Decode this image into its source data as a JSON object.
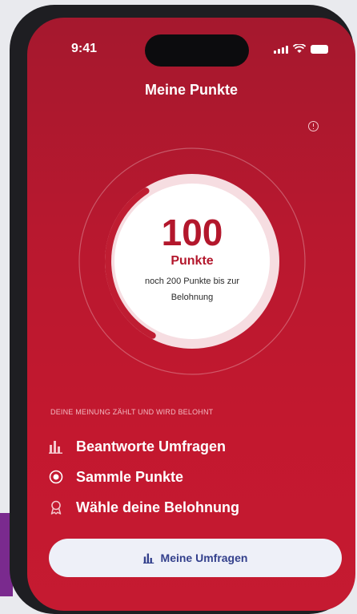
{
  "status_bar": {
    "time": "9:41"
  },
  "header": {
    "title": "Meine Punkte"
  },
  "points": {
    "value": "100",
    "label": "Punkte",
    "note": "noch 200 Punkte bis zur Belohnung",
    "progress_fraction": 0.33
  },
  "section": {
    "header": "DEINE MEINUNG ZÄHLT UND WIRD BELOHNT"
  },
  "steps": [
    {
      "icon": "bar-chart-icon",
      "label": "Beantworte Umfragen"
    },
    {
      "icon": "radio-target-icon",
      "label": "Sammle Punkte"
    },
    {
      "icon": "award-ribbon-icon",
      "label": "Wähle deine Belohnung"
    }
  ],
  "cta": {
    "icon": "bar-chart-icon",
    "label": "Meine Umfragen"
  },
  "colors": {
    "accent": "#b3172c",
    "background": "#c3182f",
    "button_text": "#33408c"
  }
}
